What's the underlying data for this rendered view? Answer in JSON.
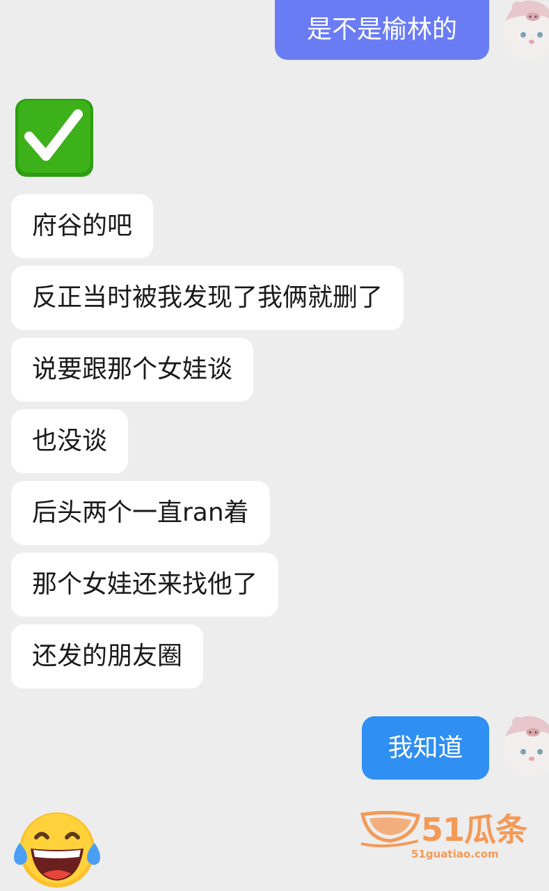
{
  "messages": {
    "sent_1": "是不是榆林的",
    "recv_1": "府谷的吧",
    "recv_2": "反正当时被我发现了我俩就删了",
    "recv_3": "说要跟那个女娃谈",
    "recv_4": "也没谈",
    "recv_5": "后头两个一直ran着",
    "recv_6": "那个女娃还来找他了",
    "recv_7": "还发的朋友圈",
    "sent_2": "我知道"
  },
  "stickers": {
    "check": "check-mark-icon",
    "laugh": "tears-of-joy-icon"
  },
  "watermark": {
    "brand": "51瓜条",
    "url": "51guatiao.com"
  },
  "colors": {
    "background": "#ededed",
    "bubble_received": "#ffffff",
    "bubble_sent_1": "#6a7cf4",
    "bubble_sent_2": "#2f8ff2",
    "watermark": "#f39a57",
    "check_green": "#3cb119"
  }
}
